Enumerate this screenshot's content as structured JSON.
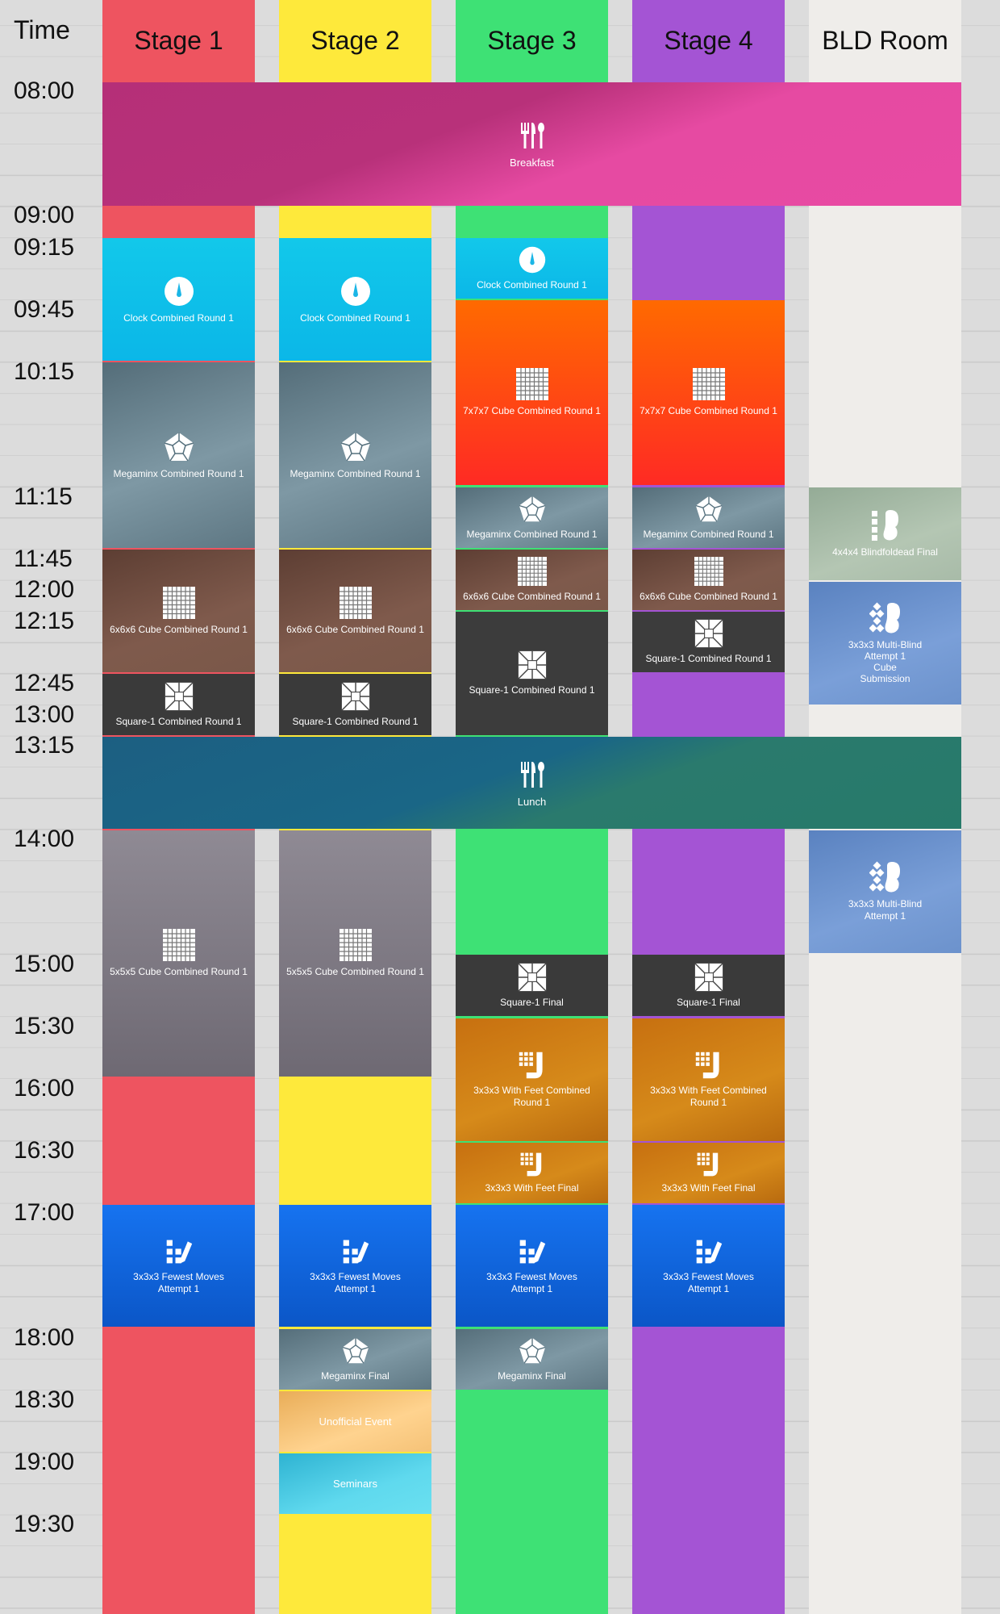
{
  "time_header": "Time",
  "times": [
    "08:00",
    "09:00",
    "09:15",
    "09:45",
    "10:15",
    "11:15",
    "11:45",
    "12:00",
    "12:15",
    "12:45",
    "13:00",
    "13:15",
    "14:00",
    "15:00",
    "15:30",
    "16:00",
    "16:30",
    "17:00",
    "18:00",
    "18:30",
    "19:00",
    "19:30"
  ],
  "columns": [
    {
      "name": "Stage 1",
      "color": "#ee5460"
    },
    {
      "name": "Stage 2",
      "color": "#fee93b"
    },
    {
      "name": "Stage 3",
      "color": "#3ee175"
    },
    {
      "name": "Stage 4",
      "color": "#a454d4"
    },
    {
      "name": "BLD Room",
      "color": "#efedea"
    }
  ],
  "shared_events": {
    "breakfast": {
      "label": "Breakfast",
      "icon": "cutlery-icon"
    },
    "lunch": {
      "label": "Lunch",
      "icon": "cutlery-icon"
    }
  },
  "events": {
    "s1_clock": "Clock Combined Round 1",
    "s1_mega": "Megaminx Combined Round 1",
    "s1_666": "6x6x6 Cube Combined Round 1",
    "s1_sq1": "Square-1 Combined Round 1",
    "s1_555": "5x5x5 Cube Combined Round 1",
    "s1_fmc_a": "3x3x3 Fewest Moves",
    "s1_fmc_b": "Attempt 1",
    "s2_clock": "Clock Combined Round 1",
    "s2_mega": "Megaminx Combined Round 1",
    "s2_666": "6x6x6 Cube Combined Round 1",
    "s2_sq1": "Square-1 Combined Round 1",
    "s2_555": "5x5x5 Cube Combined Round 1",
    "s2_fmc_a": "3x3x3 Fewest Moves",
    "s2_fmc_b": "Attempt 1",
    "s2_megafinal": "Megaminx Final",
    "s2_unofficial": "Unofficial Event",
    "s2_seminars": "Seminars",
    "s3_clock": "Clock Combined Round 1",
    "s3_777": "7x7x7 Cube Combined Round 1",
    "s3_mega": "Megaminx Combined Round 1",
    "s3_666": "6x6x6 Cube Combined Round 1",
    "s3_sq1": "Square-1 Combined Round 1",
    "s3_sq1final": "Square-1 Final",
    "s3_feet_a": "3x3x3 With Feet Combined",
    "s3_feet_b": "Round 1",
    "s3_feetfinal": "3x3x3 With Feet Final",
    "s3_fmc_a": "3x3x3 Fewest Moves",
    "s3_fmc_b": "Attempt 1",
    "s3_megafinal": "Megaminx Final",
    "s4_777": "7x7x7 Cube Combined Round 1",
    "s4_mega": "Megaminx Combined Round 1",
    "s4_666": "6x6x6 Cube Combined Round 1",
    "s4_sq1": "Square-1 Combined Round 1",
    "s4_sq1final": "Square-1 Final",
    "s4_feet_a": "3x3x3 With Feet Combined",
    "s4_feet_b": "Round 1",
    "s4_feetfinal": "3x3x3 With Feet Final",
    "s4_fmc_a": "3x3x3 Fewest Moves",
    "s4_fmc_b": "Attempt 1",
    "bld_444": "4x4x4 Blindfoldead Final",
    "bld_mbld1_a": "3x3x3 Multi-Blind",
    "bld_mbld1_b": "Attempt 1",
    "bld_mbld1_c": "Cube",
    "bld_mbld1_d": "Submission",
    "bld_mbld2_a": "3x3x3 Multi-Blind",
    "bld_mbld2_b": "Attempt 1"
  }
}
